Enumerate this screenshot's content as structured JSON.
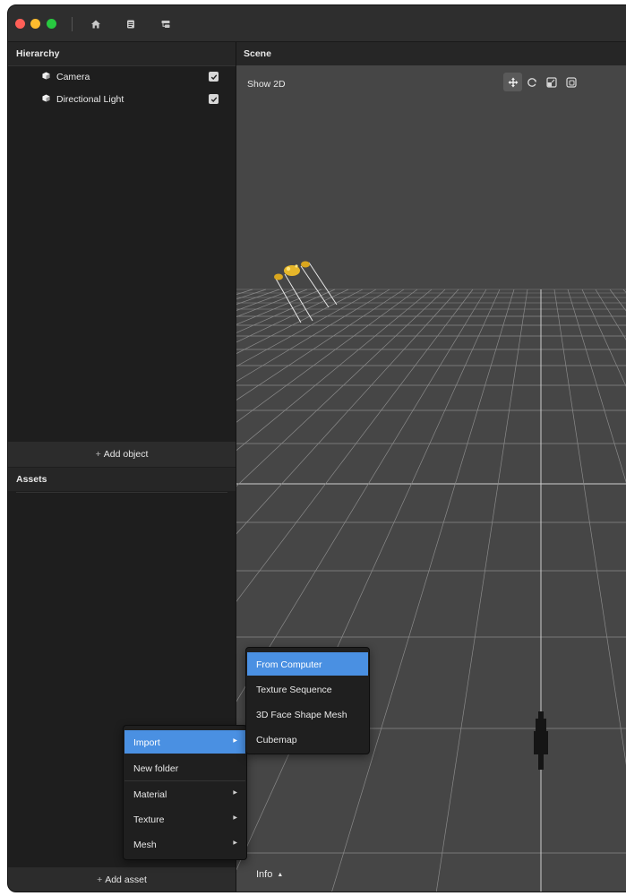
{
  "colors": {
    "accent": "#4a90e2",
    "object_yellow": "#e6b62a",
    "panel_bg": "#1e1e1e",
    "scene_bg": "#464646"
  },
  "toolbar": {
    "icons": [
      "home-icon",
      "document-icon",
      "hierarchy-icon"
    ]
  },
  "hierarchy": {
    "title": "Hierarchy",
    "items": [
      {
        "label": "Camera",
        "icon": "cube-icon",
        "visible": true
      },
      {
        "label": "Directional Light",
        "icon": "cube-icon",
        "visible": true
      }
    ],
    "add_label": "Add object"
  },
  "assets": {
    "title": "Assets",
    "add_label": "Add asset"
  },
  "scene": {
    "title": "Scene",
    "show2d_label": "Show 2D",
    "tools": [
      "move-tool-icon",
      "rotate-tool-icon",
      "scale-tool-icon",
      "rect-tool-icon"
    ],
    "active_tool": "move-tool-icon",
    "info_label": "Info"
  },
  "context_menu": {
    "items": [
      {
        "label": "Import",
        "submenu": true,
        "highlighted": true
      },
      {
        "label": "New folder",
        "submenu": false
      },
      {
        "label": "Material",
        "submenu": true
      },
      {
        "label": "Texture",
        "submenu": true
      },
      {
        "label": "Mesh",
        "submenu": true
      }
    ]
  },
  "import_submenu": {
    "items": [
      {
        "label": "From Computer",
        "highlighted": true
      },
      {
        "label": "Texture Sequence"
      },
      {
        "label": "3D Face Shape Mesh"
      },
      {
        "label": "Cubemap"
      }
    ]
  }
}
